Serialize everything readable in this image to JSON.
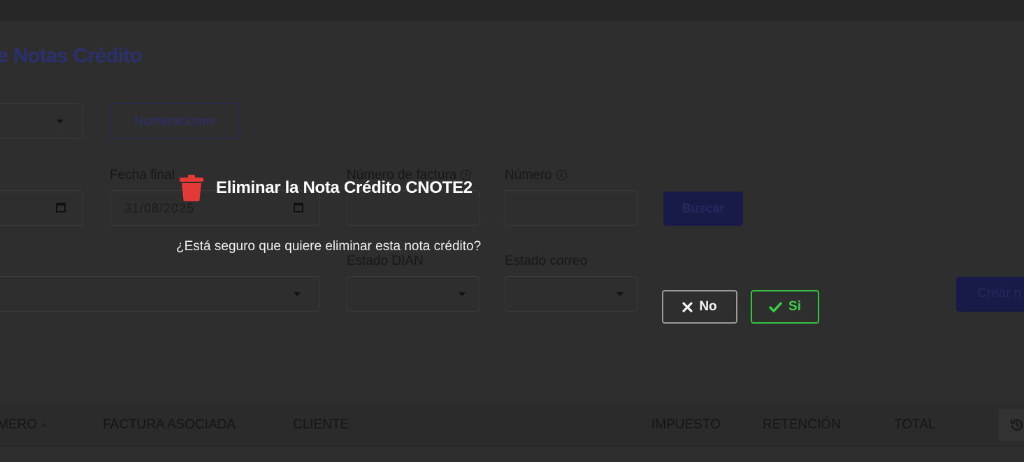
{
  "page": {
    "title": "e Notas Crédito",
    "numeraciones_label": "Numeraciones",
    "buscar_label": "Buscar",
    "crear_label": "Crear n"
  },
  "filters": {
    "fecha_final_label": "Fecha final",
    "fecha_final_value": "31/08/2025",
    "numero_factura_label": "Número de factura",
    "numero_label": "Número",
    "estado_dian_label": "Estado DIAN",
    "estado_correo_label": "Estado correo"
  },
  "table": {
    "headers": [
      "MERO",
      "FACTURA ASOCIADA",
      "CLIENTE",
      "IMPUESTO",
      "RETENCIÓN",
      "TOTAL"
    ]
  },
  "dialog": {
    "title": "Eliminar la Nota Crédito CNOTE2",
    "message": "¿Está seguro que quiere eliminar esta nota crédito?",
    "no_label": "No",
    "si_label": "Si",
    "colors": {
      "trash": "#e53935",
      "si": "#36c33f",
      "no": "#9a9a9a"
    },
    "icons": [
      "trash-icon",
      "x-icon",
      "check-icon"
    ]
  }
}
